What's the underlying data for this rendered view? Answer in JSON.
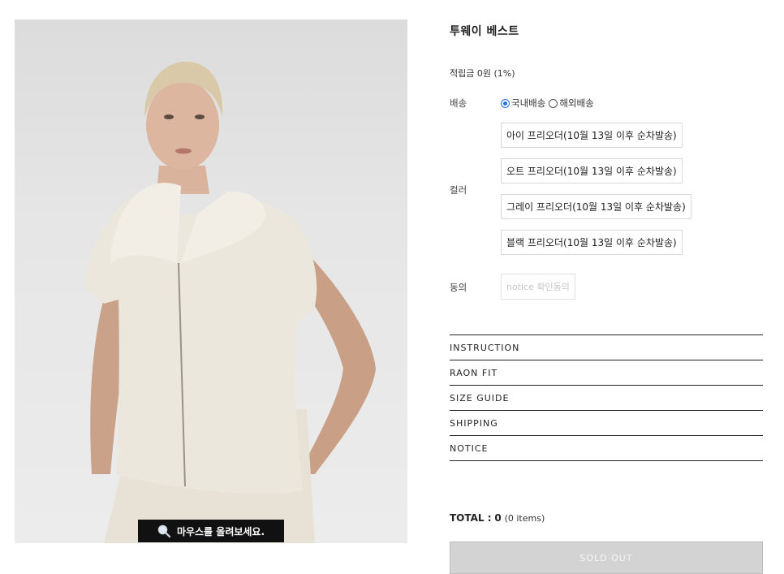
{
  "product": {
    "title": "투웨이 베스트",
    "reward": "적립금 0원 (1%)",
    "image_alt": "product photo: model wearing cream zip-up knit vest",
    "zoom_hint": "마우스를 올려보세요."
  },
  "shipping": {
    "label": "배송",
    "options": [
      {
        "label": "국내배송",
        "selected": true
      },
      {
        "label": "해외배송",
        "selected": false
      }
    ]
  },
  "color": {
    "label": "컬러",
    "options": [
      "아이 프리오더(10월 13일 이후 순차발송)",
      "오트 프리오더(10월 13일 이후 순차발송)",
      "그레이 프리오더(10월 13일 이후 순차발송)",
      "블랙 프리오더(10월 13일 이후 순차발송)"
    ]
  },
  "agree": {
    "label": "동의",
    "option": "notice 확인동의"
  },
  "accordion": [
    "INSTRUCTION",
    "RAON FIT",
    "SIZE GUIDE",
    "SHIPPING",
    "NOTICE"
  ],
  "total": {
    "label": "TOTAL :",
    "amount": "0",
    "items": "(0 items)"
  },
  "buy_button": "SOLD OUT",
  "colors": {
    "radio_selected": "#2a6fdb",
    "soldout_bg": "#d3d3d3"
  }
}
